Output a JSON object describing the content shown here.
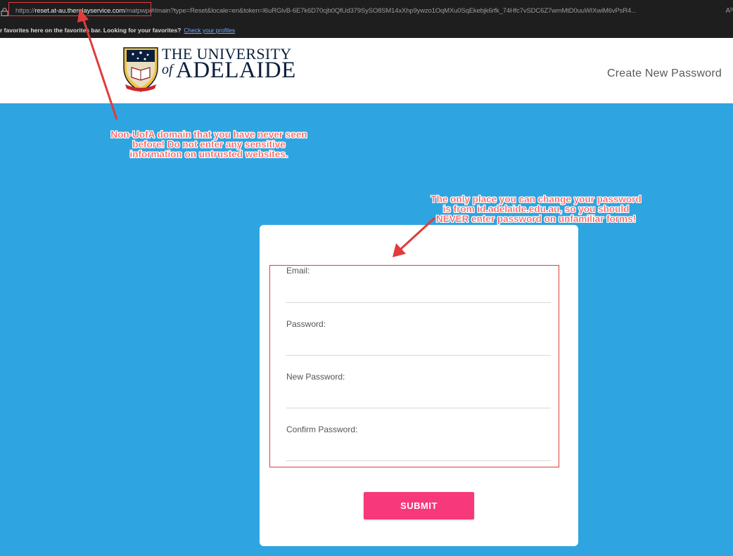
{
  "browser": {
    "url_scheme": "https://",
    "url_host": "reset.at-au.therelayservice.com",
    "url_path": "/matpwp/#/main?type=Reset&locale=en&token=l6uRGlvB-6E7k6D70cjb0QfUd379SySO8SM14xXhp9ywzo1OqMXu0SqEkebjk6rfk_74Hfc7vSDC6Z7wmMtD0uuWIXwiM6vPsR4...",
    "read_aloud": "Aᵇ",
    "favorites_text": "r favorites here on the favorites bar. Looking for your favorites?",
    "favorites_link": "Check your profiles"
  },
  "header": {
    "logo_line1": "THE UNIVERSITY",
    "logo_of": "of",
    "logo_line2": "ADELAIDE",
    "page_title": "Create New Password"
  },
  "form": {
    "fields": [
      {
        "label": "Email:",
        "value": ""
      },
      {
        "label": "Password:",
        "value": ""
      },
      {
        "label": "New Password:",
        "value": ""
      },
      {
        "label": "Confirm Password:",
        "value": ""
      }
    ],
    "submit_label": "SUBMIT"
  },
  "annotations": {
    "domain_warning": "Non-UofA domain that you have never seen before! Do not enter any sensitive information on untrusted websites.",
    "password_warning": "The only place you can change your password is from id.adelaide.edu.au, so you should NEVER enter password on unfamiliar forms!"
  },
  "colors": {
    "background": "#2ea5e0",
    "submit": "#f7387a",
    "annotation": "#e03c3c",
    "logo_navy": "#0b1f3d"
  }
}
